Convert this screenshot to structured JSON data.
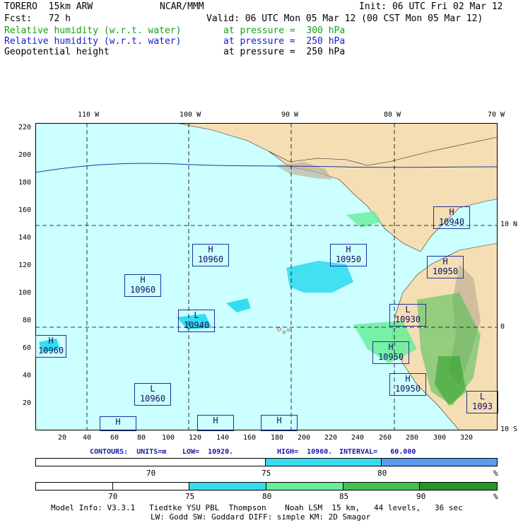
{
  "header": {
    "model": "TORERO  15km ARW",
    "center": "NCAR/MMM",
    "init": "Init: 06 UTC Fri 02 Mar 12",
    "fcst": "Fcst:   72 h",
    "valid": "Valid: 06 UTC Mon 05 Mar 12 (00 CST Mon 05 Mar 12)",
    "fields": [
      {
        "name": "Relative humidity (w.r.t. water)",
        "level": "at pressure =  300 hPa",
        "color": "#18a018"
      },
      {
        "name": "Relative humidity (w.r.t. water)",
        "level": "at pressure =  250 hPa",
        "color": "#1818d0"
      },
      {
        "name": "Geopotential height",
        "level": "at pressure =  250 hPa",
        "color": "#000000"
      }
    ]
  },
  "map": {
    "lon_labels": [
      "110 W",
      "100 W",
      "90 W",
      "80 W",
      "70 W"
    ],
    "lat_labels_right": [
      "10 N",
      "0",
      "10 S"
    ],
    "y_ticks": [
      "220",
      "200",
      "180",
      "160",
      "140",
      "120",
      "100",
      "80",
      "60",
      "40",
      "20"
    ],
    "x_ticks": [
      "20",
      "40",
      "60",
      "80",
      "100",
      "120",
      "140",
      "160",
      "180",
      "200",
      "220",
      "240",
      "260",
      "280",
      "300",
      "320"
    ],
    "colors": {
      "ocean": "#ccffff",
      "land": "#f5deb3",
      "rh75": "#33ddee",
      "rh80": "#5a9cf0"
    },
    "pressure_centers": [
      {
        "type": "H",
        "value": "10960"
      },
      {
        "type": "H",
        "value": "10960"
      },
      {
        "type": "H",
        "value": "10950"
      },
      {
        "type": "H",
        "value": "10940"
      },
      {
        "type": "H",
        "value": "10950"
      },
      {
        "type": "L",
        "value": "10940"
      },
      {
        "type": "L",
        "value": "10930"
      },
      {
        "type": "H",
        "value": "10960"
      },
      {
        "type": "H",
        "value": "10950"
      },
      {
        "type": "H",
        "value": "10950"
      },
      {
        "type": "L",
        "value": "10960"
      },
      {
        "type": "L",
        "value": "1093"
      },
      {
        "type": "H",
        "value": ""
      },
      {
        "type": "H",
        "value": ""
      },
      {
        "type": "H",
        "value": ""
      }
    ]
  },
  "contours": {
    "units_label": "CONTOURS:  UNITS=m",
    "low": "LOW=  10920.",
    "high": "HIGH=  10960.",
    "interval": "INTERVAL=   60.000"
  },
  "colorbar1": {
    "labels": [
      "70",
      "75",
      "80",
      "%"
    ],
    "colors": [
      "#ffffff",
      "#33ddee",
      "#5a9cf0"
    ]
  },
  "colorbar2": {
    "labels": [
      "70",
      "75",
      "80",
      "85",
      "90",
      "%"
    ],
    "colors": [
      "#ffffff",
      "#ffffff",
      "#33ddee",
      "#66ee99",
      "#44c050",
      "#229922"
    ]
  },
  "footer": {
    "line1": "Model Info: V3.3.1   Tiedtke YSU PBL  Thompson    Noah LSM  15 km,   44 levels,   36 sec",
    "line2": "LW: Godd SW: Goddard DIFF: simple KM: 2D Smagor"
  }
}
